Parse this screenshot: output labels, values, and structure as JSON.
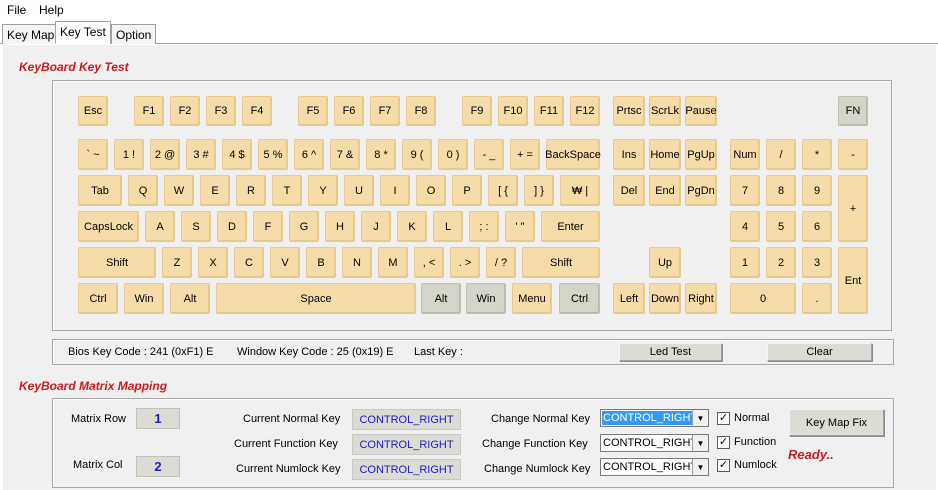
{
  "menu": {
    "file": "File",
    "help": "Help"
  },
  "tabs": [
    "Key Map",
    "Key Test",
    "Option"
  ],
  "keytest_title": "KeyBoard Key Test",
  "matrix_title": "KeyBoard Matrix Mapping",
  "keys": {
    "esc": "Esc",
    "f1": "F1",
    "f2": "F2",
    "f3": "F3",
    "f4": "F4",
    "f5": "F5",
    "f6": "F6",
    "f7": "F7",
    "f8": "F8",
    "f9": "F9",
    "f10": "F10",
    "f11": "F11",
    "f12": "F12",
    "prtsc": "Prtsc",
    "scrlk": "ScrLk",
    "pause": "Pause",
    "fn": "FN",
    "grave": "` ~",
    "d1": "1 !",
    "d2": "2 @",
    "d3": "3 #",
    "d4": "4 $",
    "d5": "5 %",
    "d6": "6 ^",
    "d7": "7 &",
    "d8": "8 *",
    "d9": "9 (",
    "d0": "0 )",
    "minus": "- _",
    "equal": "+ =",
    "backspace": "BackSpace",
    "ins": "Ins",
    "home": "Home",
    "pgup": "PgUp",
    "numlock": "Num",
    "kp_div": "/",
    "kp_mul": "*",
    "kp_sub": "-",
    "tab": "Tab",
    "q": "Q",
    "w": "W",
    "e": "E",
    "r": "R",
    "t": "T",
    "y": "Y",
    "u": "U",
    "i": "I",
    "o": "O",
    "p": "P",
    "lbracket": "[ {",
    "rbracket": "] }",
    "won": "₩ |",
    "del": "Del",
    "end": "End",
    "pgdn": "PgDn",
    "kp7": "7",
    "kp8": "8",
    "kp9": "9",
    "kp_add": "+",
    "capslock": "CapsLock",
    "a": "A",
    "s": "S",
    "d": "D",
    "f": "F",
    "g": "G",
    "h": "H",
    "j": "J",
    "k": "K",
    "l": "L",
    "semicolon": "; :",
    "quote": "' \"",
    "enter": "Enter",
    "kp4": "4",
    "kp5": "5",
    "kp6": "6",
    "lshift": "Shift",
    "z": "Z",
    "x": "X",
    "c": "C",
    "v": "V",
    "b": "B",
    "n": "N",
    "m": "M",
    "comma": ", <",
    "period": ". >",
    "slash": "/ ?",
    "rshift": "Shift",
    "up": "Up",
    "kp1": "1",
    "kp2": "2",
    "kp3": "3",
    "kp_enter": "Ent",
    "lctrl": "Ctrl",
    "lwin": "Win",
    "lalt": "Alt",
    "space": "Space",
    "ralt": "Alt",
    "rwin": "Win",
    "menu": "Menu",
    "rctrl": "Ctrl",
    "left": "Left",
    "down": "Down",
    "right": "Right",
    "kp0": "0",
    "kp_dot": "."
  },
  "status": {
    "bios_key_code": "Bios Key Code : 241 (0xF1) E",
    "window_key_code": "Window Key Code : 25 (0x19) E",
    "last_key": "Last Key :",
    "led_test": "Led Test",
    "clear": "Clear"
  },
  "matrix": {
    "row_label": "Matrix Row",
    "row_value": "1",
    "col_label": "Matrix Col",
    "col_value": "2",
    "current_normal_label": "Current Normal Key",
    "current_normal_value": "CONTROL_RIGHT",
    "current_function_label": "Current Function Key",
    "current_function_value": "CONTROL_RIGHT",
    "current_numlock_label": "Current Numlock Key",
    "current_numlock_value": "CONTROL_RIGHT",
    "change_normal_label": "Change Normal Key",
    "change_normal_value": "CONTROL_RIGHT",
    "change_function_label": "Change Function Key",
    "change_function_value": "CONTROL_RIGHT",
    "change_numlock_label": "Change Numlock Key",
    "change_numlock_value": "CONTROL_RIGHT",
    "normal_check": "Normal",
    "function_check": "Function",
    "numlock_check": "Numlock",
    "key_map_fix": "Key Map Fix",
    "ready": "Ready.."
  }
}
